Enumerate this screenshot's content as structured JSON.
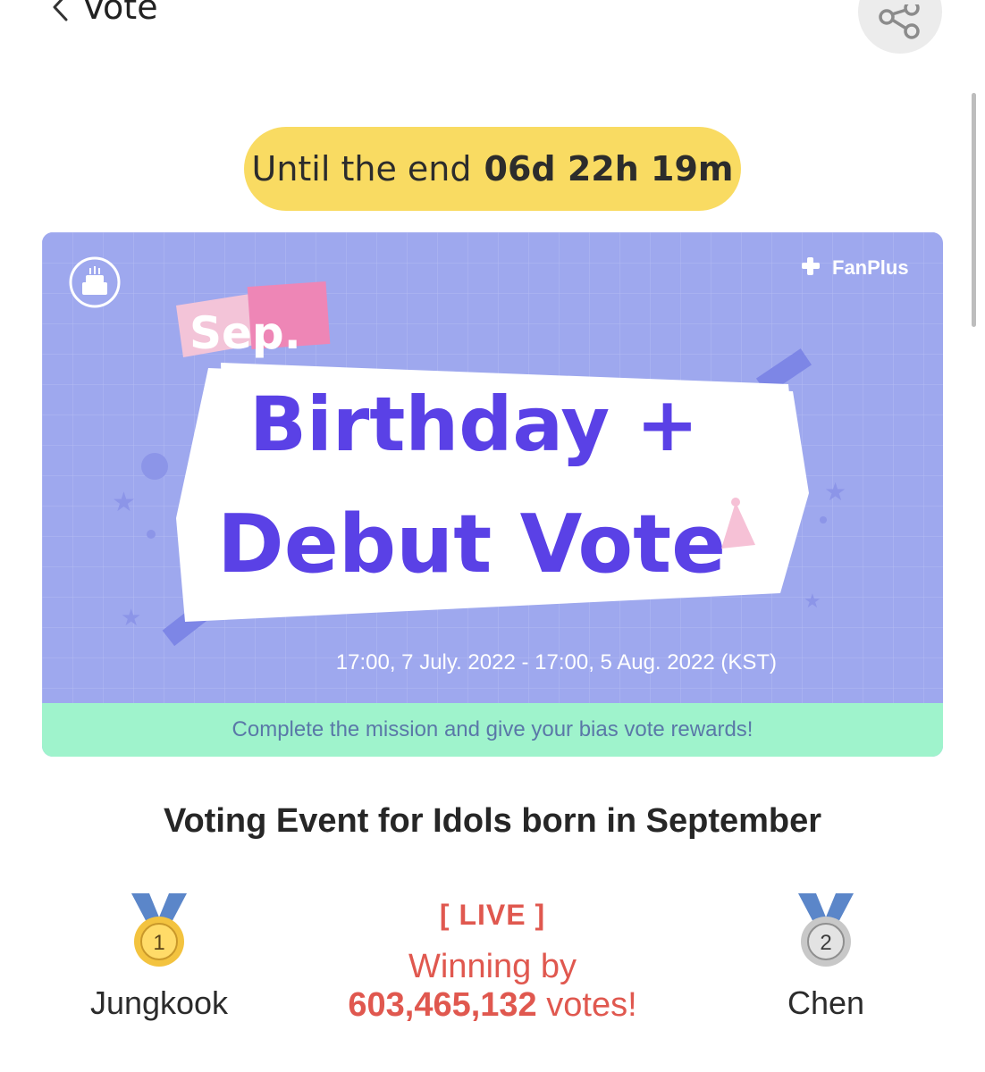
{
  "header": {
    "title": "Vote",
    "back_icon": "chevron-left-icon",
    "share_icon": "share-icon"
  },
  "timer": {
    "prefix": "Until the end",
    "value": "06d 22h 19m"
  },
  "banner": {
    "brand": "FanPlus",
    "tag": "Sep.",
    "headline_line1": "Birthday +",
    "headline_line2": "Debut Vote",
    "date_range": "17:00, 7 July. 2022 - 17:00, 5 Aug. 2022 (KST)",
    "mission": "Complete the mission and give your bias vote rewards!",
    "badge_icon": "birthday-cake-icon",
    "colors": {
      "background": "#9ea8ee",
      "headline": "#5a41e6",
      "mission_bg": "#9ff3cc",
      "tag_pink": "#f1a7c7"
    }
  },
  "event": {
    "title": "Voting Event for Idols born in September"
  },
  "ranking": {
    "first": {
      "rank": "1",
      "name": "Jungkook",
      "icon": "gold-medal-icon"
    },
    "second": {
      "rank": "2",
      "name": "Chen",
      "icon": "silver-medal-icon"
    },
    "live_label": "[ LIVE ]",
    "winning_label": "Winning by",
    "votes_number": "603,465,132",
    "votes_suffix": "votes!"
  }
}
